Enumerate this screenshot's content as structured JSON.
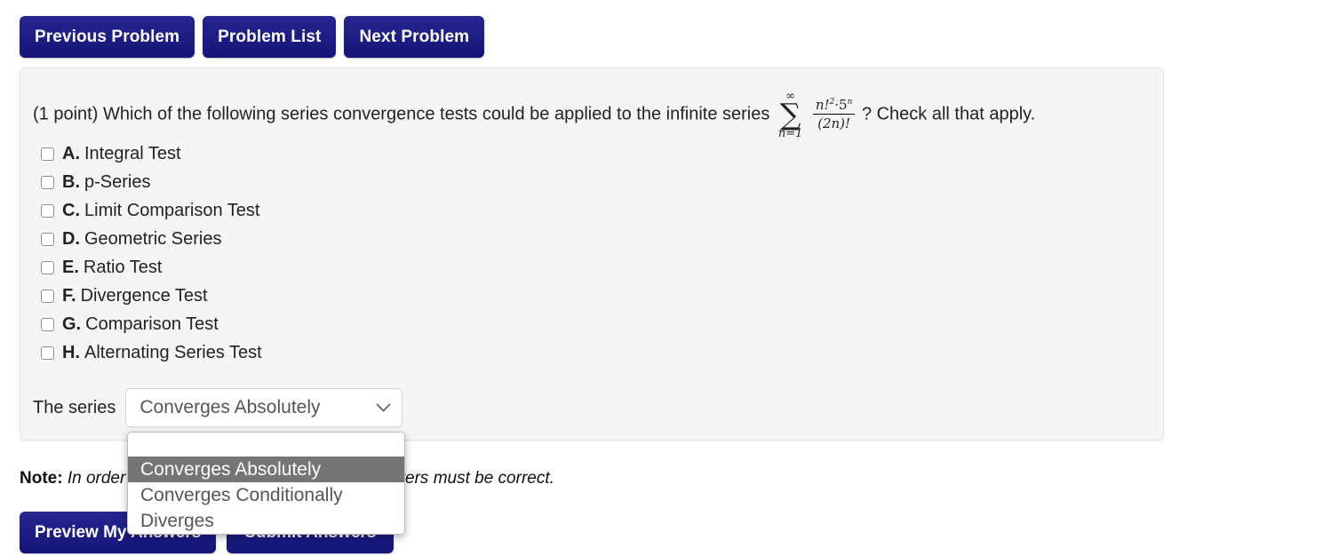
{
  "nav": {
    "buttons": [
      {
        "label": "Previous Problem",
        "name": "previous-problem-button"
      },
      {
        "label": "Problem List",
        "name": "problem-list-button"
      },
      {
        "label": "Next Problem",
        "name": "next-problem-button"
      }
    ]
  },
  "problem": {
    "points": "(1 point)",
    "question_before": "Which of the following series convergence tests could be applied to the infinite series",
    "question_after": "? Check all that apply.",
    "math": {
      "sum_upper": "∞",
      "sum_sign": "∑",
      "sum_lower": "n=1",
      "numerator": "n!",
      "numerator_exp": "2",
      "numerator_rest": "·5",
      "numerator_rest_exp": "n",
      "denominator": "(2n)!",
      "plain": "sum_{n=1}^{∞} (n!^2 · 5^n) / (2n)!"
    },
    "choices": [
      {
        "letter": "A.",
        "label": "Integral Test",
        "checked": false
      },
      {
        "letter": "B.",
        "label": "p-Series",
        "checked": false
      },
      {
        "letter": "C.",
        "label": "Limit Comparison Test",
        "checked": false
      },
      {
        "letter": "D.",
        "label": "Geometric Series",
        "checked": false
      },
      {
        "letter": "E.",
        "label": "Ratio Test",
        "checked": false
      },
      {
        "letter": "F.",
        "label": "Divergence Test",
        "checked": false
      },
      {
        "letter": "G.",
        "label": "Comparison Test",
        "checked": false
      },
      {
        "letter": "H.",
        "label": "Alternating Series Test",
        "checked": false
      }
    ],
    "series_label": "The series",
    "select": {
      "value": "Converges Absolutely",
      "expanded": true,
      "options": [
        {
          "label": "",
          "selected": false
        },
        {
          "label": "Converges Absolutely",
          "selected": true
        },
        {
          "label": "Converges Conditionally",
          "selected": false
        },
        {
          "label": "Diverges",
          "selected": false
        }
      ]
    }
  },
  "note": {
    "prefix": "Note:",
    "text": "In order to get credit for this problem all answers must be correct."
  },
  "actions": {
    "buttons": [
      {
        "label": "Preview My Answers",
        "name": "preview-my-answers-button"
      },
      {
        "label": "Submit Answers",
        "name": "submit-answers-button"
      }
    ]
  },
  "colors": {
    "button_navy": "#1e1e85",
    "panel_bg": "#f5f5f5",
    "highlight_gray": "#757575"
  }
}
